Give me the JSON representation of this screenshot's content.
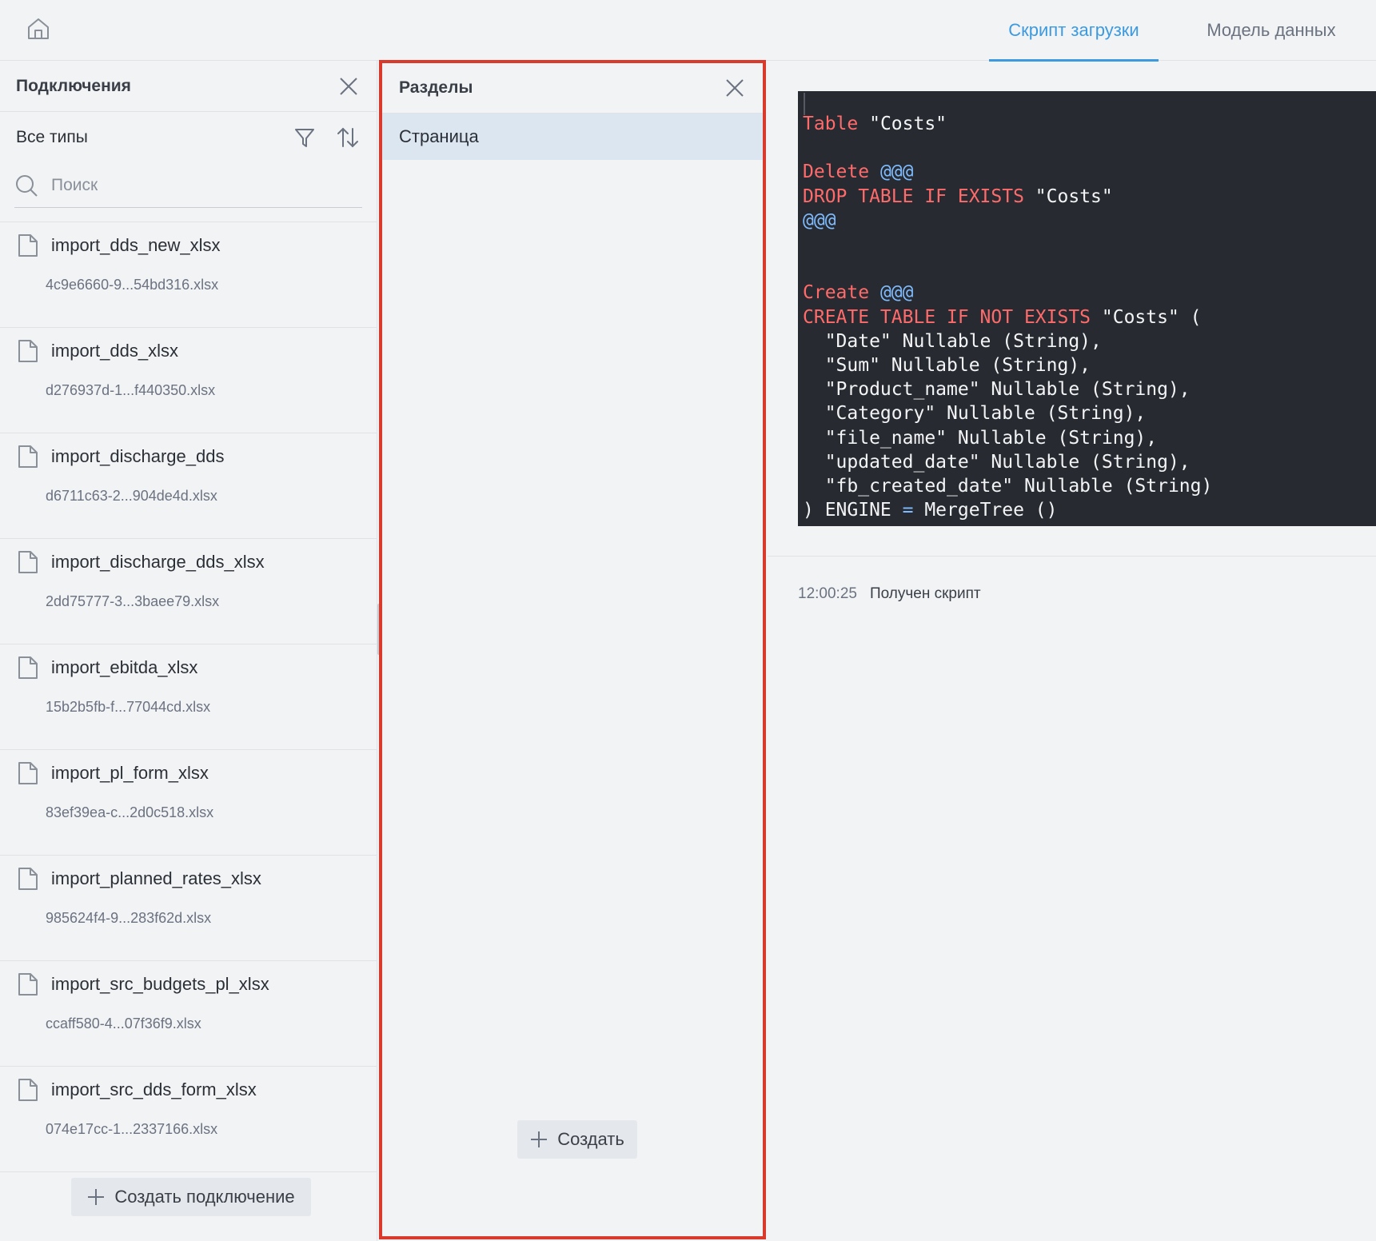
{
  "topbar": {
    "tabs": [
      {
        "label": "Скрипт загрузки",
        "active": true
      },
      {
        "label": "Модель данных",
        "active": false
      }
    ]
  },
  "connections": {
    "title": "Подключения",
    "filter_label": "Все типы",
    "search_placeholder": "Поиск",
    "items": [
      {
        "name": "import_dds_new_xlsx",
        "file": "4c9e6660-9...54bd316.xlsx"
      },
      {
        "name": "import_dds_xlsx",
        "file": "d276937d-1...f440350.xlsx"
      },
      {
        "name": "import_discharge_dds",
        "file": "d6711c63-2...904de4d.xlsx"
      },
      {
        "name": "import_discharge_dds_xlsx",
        "file": "2dd75777-3...3baee79.xlsx"
      },
      {
        "name": "import_ebitda_xlsx",
        "file": "15b2b5fb-f...77044cd.xlsx"
      },
      {
        "name": "import_pl_form_xlsx",
        "file": "83ef39ea-c...2d0c518.xlsx"
      },
      {
        "name": "import_planned_rates_xlsx",
        "file": "985624f4-9...283f62d.xlsx"
      },
      {
        "name": "import_src_budgets_pl_xlsx",
        "file": "ccaff580-4...07f36f9.xlsx"
      },
      {
        "name": "import_src_dds_form_xlsx",
        "file": "074e17cc-1...2337166.xlsx"
      }
    ],
    "create_label": "Создать подключение"
  },
  "sections": {
    "title": "Разделы",
    "items": [
      {
        "label": "Страница"
      }
    ],
    "create_label": "Создать"
  },
  "editor": {
    "lines": [
      [
        {
          "t": "Table",
          "c": "kw"
        },
        {
          "t": " \"Costs\""
        }
      ],
      [],
      [
        {
          "t": "Delete",
          "c": "kw"
        },
        {
          "t": " "
        },
        {
          "t": "@@@",
          "c": "at"
        }
      ],
      [
        {
          "t": "DROP TABLE IF EXISTS",
          "c": "kw"
        },
        {
          "t": " \"Costs\""
        }
      ],
      [
        {
          "t": "@@@",
          "c": "at"
        }
      ],
      [],
      [],
      [
        {
          "t": "Create",
          "c": "kw"
        },
        {
          "t": " "
        },
        {
          "t": "@@@",
          "c": "at"
        }
      ],
      [
        {
          "t": "CREATE TABLE IF NOT EXISTS",
          "c": "kw"
        },
        {
          "t": " \"Costs\" ("
        }
      ],
      [
        {
          "t": "  \"Date\" Nullable (String),"
        }
      ],
      [
        {
          "t": "  \"Sum\" Nullable (String),"
        }
      ],
      [
        {
          "t": "  \"Product_name\" Nullable (String),"
        }
      ],
      [
        {
          "t": "  \"Category\" Nullable (String),"
        }
      ],
      [
        {
          "t": "  \"file_name\" Nullable (String),"
        }
      ],
      [
        {
          "t": "  \"updated_date\" Nullable (String),"
        }
      ],
      [
        {
          "t": "  \"fb_created_date\" Nullable (String)"
        }
      ],
      [
        {
          "t": ") ENGINE "
        },
        {
          "t": "=",
          "c": "at"
        },
        {
          "t": " MergeTree ()"
        }
      ]
    ]
  },
  "log": {
    "time": "12:00:25",
    "message": "Получен скрипт"
  },
  "colors": {
    "accent": "#3b9ae0",
    "highlight_border": "#d93a2b",
    "editor_bg": "#272a30",
    "keyword": "#ff6b6b",
    "delimiter": "#7fbcff"
  }
}
